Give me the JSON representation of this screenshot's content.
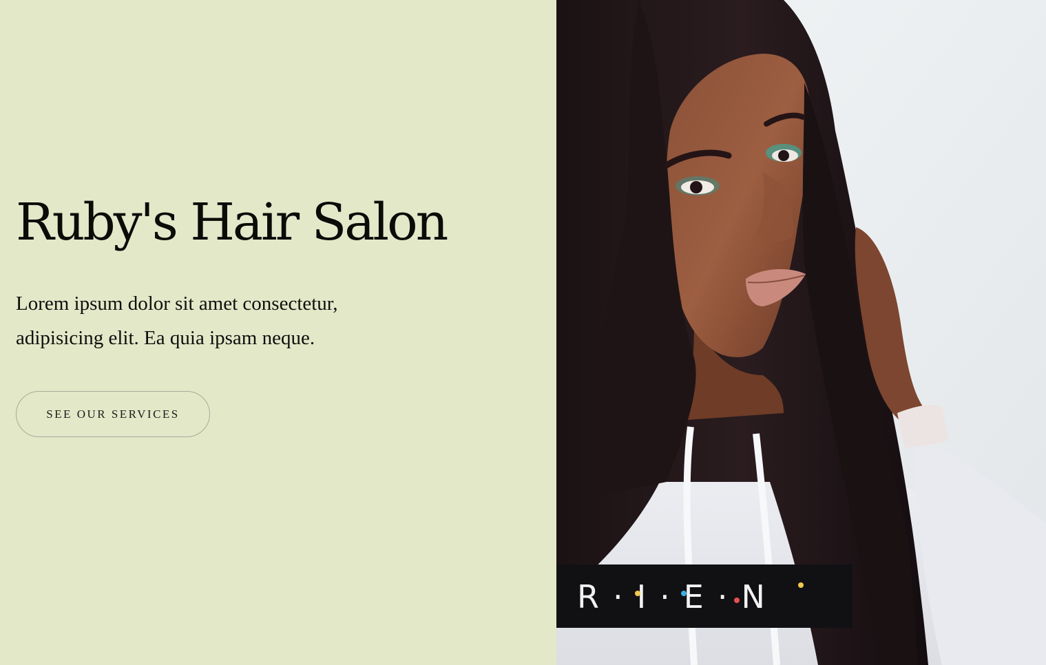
{
  "hero": {
    "title": "Ruby's Hair Salon",
    "text": "Lorem ipsum dolor sit amet consectetur, adipisicing elit. Ea quia ipsam neque.",
    "cta_label": "SEE OUR SERVICES"
  },
  "image": {
    "subject": "portrait-woman-long-dark-hair-white-hoodie",
    "hoodie_lettering": "R·I·E·N"
  },
  "colors": {
    "left_panel_bg": "#e3e8c9",
    "text": "#0b0b08",
    "button_border": "#a9ab98"
  }
}
